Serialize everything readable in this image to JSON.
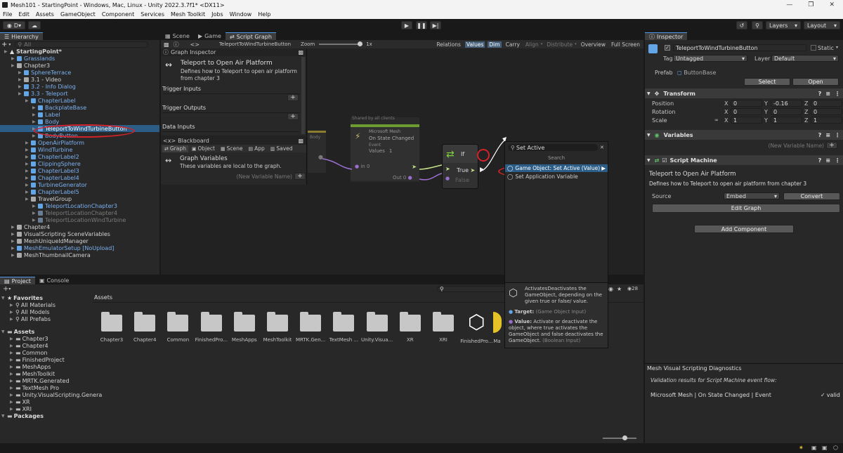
{
  "window": {
    "title": "Mesh101 - StartingPoint - Windows, Mac, Linux - Unity 2022.3.7f1* <DX11>"
  },
  "menu": [
    "File",
    "Edit",
    "Assets",
    "GameObject",
    "Component",
    "Services",
    "Mesh Toolkit",
    "Jobs",
    "Window",
    "Help"
  ],
  "toolbar": {
    "account": "D",
    "layers": "Layers",
    "layout": "Layout"
  },
  "hierarchy": {
    "tab": "Hierarchy",
    "search_placeholder": "All",
    "items": [
      {
        "label": "StartingPoint*",
        "indent": 0,
        "style": "scene"
      },
      {
        "label": "Grasslands",
        "indent": 1,
        "style": "blue"
      },
      {
        "label": "Chapter3",
        "indent": 1,
        "style": "normal"
      },
      {
        "label": "SphereTerrace",
        "indent": 2,
        "style": "blue"
      },
      {
        "label": "3.1 - Video",
        "indent": 2,
        "style": "normal"
      },
      {
        "label": "3.2 - Info Dialog",
        "indent": 2,
        "style": "blue"
      },
      {
        "label": "3.3 - Teleport",
        "indent": 2,
        "style": "blue"
      },
      {
        "label": "ChapterLabel",
        "indent": 3,
        "style": "blue"
      },
      {
        "label": "BackplateBase",
        "indent": 4,
        "style": "blue"
      },
      {
        "label": "Label",
        "indent": 4,
        "style": "blue"
      },
      {
        "label": "Body",
        "indent": 4,
        "style": "blue"
      },
      {
        "label": "TeleportToWindTurbineButton",
        "indent": 4,
        "style": "selected"
      },
      {
        "label": "BodyButton",
        "indent": 4,
        "style": "blue"
      },
      {
        "label": "OpenAirPlatform",
        "indent": 3,
        "style": "blue"
      },
      {
        "label": "WindTurbine",
        "indent": 3,
        "style": "blue"
      },
      {
        "label": "ChapterLabel2",
        "indent": 3,
        "style": "blue"
      },
      {
        "label": "ClippingSphere",
        "indent": 3,
        "style": "blue"
      },
      {
        "label": "ChapterLabel3",
        "indent": 3,
        "style": "blue"
      },
      {
        "label": "ChapterLabel4",
        "indent": 3,
        "style": "blue"
      },
      {
        "label": "TurbineGenerator",
        "indent": 3,
        "style": "blue"
      },
      {
        "label": "ChapterLabel5",
        "indent": 3,
        "style": "blue"
      },
      {
        "label": "TravelGroup",
        "indent": 3,
        "style": "normal"
      },
      {
        "label": "TeleportLocationChapter3",
        "indent": 4,
        "style": "blue"
      },
      {
        "label": "TeleportLocationChapter4",
        "indent": 4,
        "style": "faded"
      },
      {
        "label": "TeleportLocationWindTurbine",
        "indent": 4,
        "style": "faded"
      },
      {
        "label": "Chapter4",
        "indent": 1,
        "style": "normal"
      },
      {
        "label": "VisualScripting SceneVariables",
        "indent": 1,
        "style": "normal"
      },
      {
        "label": "MeshUniqueIdManager",
        "indent": 1,
        "style": "normal"
      },
      {
        "label": "MeshEmulatorSetup [NoUpload]",
        "indent": 1,
        "style": "blue"
      },
      {
        "label": "MeshThumbnailCamera",
        "indent": 1,
        "style": "normal"
      }
    ]
  },
  "center_tabs": [
    "Scene",
    "Game",
    "Script Graph"
  ],
  "graph_toolbar": {
    "breadcrumb": "TeleportToWindTurbineButton",
    "zoom_label": "Zoom",
    "zoom_value": "1x",
    "buttons": [
      "Relations",
      "Values",
      "Dim",
      "Carry",
      "Align",
      "Distribute",
      "Overview",
      "Full Screen"
    ]
  },
  "graph_inspector": {
    "tab": "Graph Inspector",
    "title": "Teleport to Open Air Platform",
    "description": "Defines how to Teleport to open air platform from chapter 3",
    "sections": [
      "Trigger Inputs",
      "Trigger Outputs",
      "Data Inputs"
    ]
  },
  "blackboard": {
    "tab": "Blackboard",
    "tabs": [
      "Graph",
      "Object",
      "Scene",
      "App",
      "Saved"
    ],
    "title": "Graph Variables",
    "description": "These variables are local to the graph.",
    "new_var_placeholder": "(New Variable Name)"
  },
  "nodes": {
    "group_label": "Shared by all clients",
    "state_node": {
      "subtitle": "Microsoft Mesh",
      "title": "On State Changed",
      "sub2": "Event",
      "values_label": "Values",
      "values_count": "1",
      "in_label": "in 0",
      "out_label": "Out 0"
    },
    "body_label": "Body",
    "if_node": {
      "title": "If",
      "true_label": "True",
      "false_label": "False"
    }
  },
  "fuzzy": {
    "search_value": "Set Active",
    "header": "Search",
    "result_selected": "Game Object: Set Active (Value)",
    "result_other": "Set Application Variable",
    "doc_description": "ActivatesDeactivates the GameObject, depending on the given true or false/ value.",
    "target_label": "Target:",
    "target_type": "(Game Object Input)",
    "value_label": "Value:",
    "value_desc": "Activate or deactivate the object, where true activates the GameObject and false deactivates the GameObject.",
    "value_type": "(Boolean Input)"
  },
  "inspector": {
    "tab": "Inspector",
    "object_name": "TeleportToWindTurbineButton",
    "static_label": "Static",
    "tag_label": "Tag",
    "tag_value": "Untagged",
    "layer_label": "Layer",
    "layer_value": "Default",
    "prefab_label": "Prefab",
    "prefab_value": "ButtonBase",
    "select_btn": "Select",
    "open_btn": "Open",
    "transform": {
      "title": "Transform",
      "rows": [
        {
          "label": "Position",
          "x": "0",
          "y": "-0.16",
          "z": "0"
        },
        {
          "label": "Rotation",
          "x": "0",
          "y": "0",
          "z": "0"
        },
        {
          "label": "Scale",
          "x": "1",
          "y": "1",
          "z": "1"
        }
      ]
    },
    "variables": {
      "title": "Variables",
      "placeholder": "(New Variable Name)"
    },
    "script_machine": {
      "title": "Script Machine",
      "graph_title": "Teleport to Open Air Platform",
      "graph_desc": "Defines how to Teleport to open air platform from chapter 3",
      "source_label": "Source",
      "source_value": "Embed",
      "convert_btn": "Convert",
      "edit_btn": "Edit Graph"
    },
    "add_component": "Add Component",
    "diagnostics": {
      "title": "Mesh Visual Scripting Diagnostics",
      "subtitle": "Validation results for Script Machine event flow:",
      "result_label": "Microsoft Mesh | On State Changed | Event",
      "result_status": "valid"
    }
  },
  "project": {
    "tabs": [
      "Project",
      "Console"
    ],
    "badge_count": "28",
    "assets_header": "Assets",
    "tree": [
      {
        "label": "Favorites",
        "indent": 0,
        "bold": true
      },
      {
        "label": "All Materials",
        "indent": 1
      },
      {
        "label": "All Models",
        "indent": 1
      },
      {
        "label": "All Prefabs",
        "indent": 1
      },
      {
        "label": "Assets",
        "indent": 0,
        "bold": true
      },
      {
        "label": "Chapter3",
        "indent": 1
      },
      {
        "label": "Chapter4",
        "indent": 1
      },
      {
        "label": "Common",
        "indent": 1
      },
      {
        "label": "FinishedProject",
        "indent": 1
      },
      {
        "label": "MeshApps",
        "indent": 1
      },
      {
        "label": "MeshToolkit",
        "indent": 1
      },
      {
        "label": "MRTK.Generated",
        "indent": 1
      },
      {
        "label": "TextMesh Pro",
        "indent": 1
      },
      {
        "label": "Unity.VisualScripting.Genera",
        "indent": 1
      },
      {
        "label": "XR",
        "indent": 1
      },
      {
        "label": "XRI",
        "indent": 1
      },
      {
        "label": "Packages",
        "indent": 0,
        "bold": true
      }
    ],
    "assets": [
      "Chapter3",
      "Chapter4",
      "Common",
      "FinishedPro...",
      "MeshApps",
      "MeshToolkit",
      "MRTK.Gen...",
      "TextMesh ...",
      "Unity.Visua...",
      "XR",
      "XRI",
      "FinishedPro...",
      "Ma"
    ]
  }
}
